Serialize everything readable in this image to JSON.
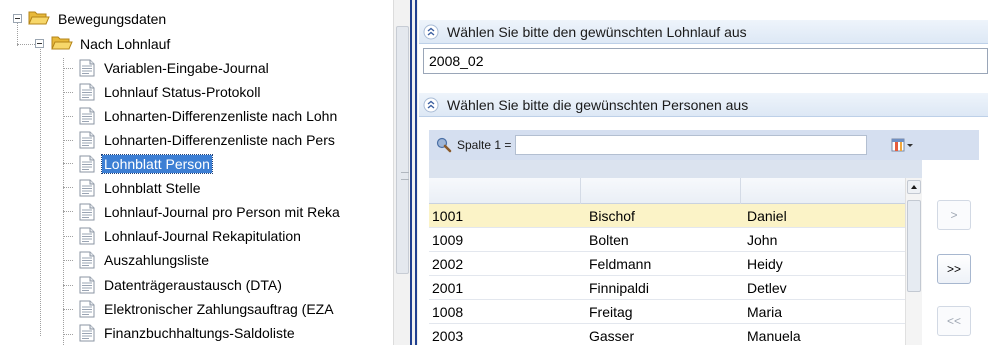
{
  "tree": {
    "root": {
      "label": "Bewegungsdaten"
    },
    "folder": {
      "label": "Nach Lohnlauf"
    },
    "items": [
      {
        "label": "Variablen-Eingabe-Journal",
        "selected": false
      },
      {
        "label": "Lohnlauf Status-Protokoll",
        "selected": false
      },
      {
        "label": "Lohnarten-Differenzenliste nach Lohn",
        "selected": false
      },
      {
        "label": "Lohnarten-Differenzenliste nach Pers",
        "selected": false
      },
      {
        "label": "Lohnblatt Person",
        "selected": true
      },
      {
        "label": "Lohnblatt Stelle",
        "selected": false
      },
      {
        "label": "Lohnlauf-Journal pro Person mit Reka",
        "selected": false
      },
      {
        "label": "Lohnlauf-Journal Rekapitulation",
        "selected": false
      },
      {
        "label": "Auszahlungsliste",
        "selected": false
      },
      {
        "label": "Datenträgeraustausch (DTA)",
        "selected": false
      },
      {
        "label": "Elektronischer Zahlungsauftrag (EZA",
        "selected": false
      },
      {
        "label": "Finanzbuchhaltungs-Saldoliste",
        "selected": false
      }
    ]
  },
  "lohnlauf": {
    "header": "Wählen Sie bitte den gewünschten Lohnlauf aus",
    "value": "2008_02"
  },
  "personen": {
    "header": "Wählen Sie bitte die gewünschten Personen aus",
    "filter_label": "Spalte 1 =",
    "filter_value": "",
    "rows": [
      {
        "nr": "1001",
        "name": "Bischof",
        "vorname": "Daniel",
        "selected": true
      },
      {
        "nr": "1009",
        "name": "Bolten",
        "vorname": "John",
        "selected": false
      },
      {
        "nr": "2002",
        "name": "Feldmann",
        "vorname": "Heidy",
        "selected": false
      },
      {
        "nr": "2001",
        "name": "Finnipaldi",
        "vorname": "Detlev",
        "selected": false
      },
      {
        "nr": "1008",
        "name": "Freitag",
        "vorname": "Maria",
        "selected": false
      },
      {
        "nr": "2003",
        "name": "Gasser",
        "vorname": "Manuela",
        "selected": false
      }
    ]
  },
  "buttons": {
    "add_one": ">",
    "add_all": ">>",
    "remove_all": "<<"
  },
  "colors": {
    "selection": "#3d7fd4",
    "row_highlight": "#fbf3c7",
    "header_gradient": "#dde8f5",
    "splitter": "#1f3f8f"
  }
}
